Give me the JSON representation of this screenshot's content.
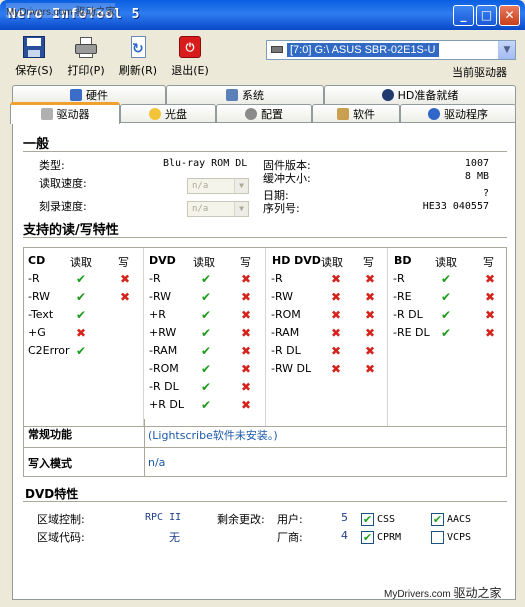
{
  "window": {
    "title": "Nero InfoTool 5",
    "watermark": "MyDrivers.com 驱动之家"
  },
  "toolbar": {
    "save": "保存(S)",
    "print": "打印(P)",
    "refresh": "刷新(R)",
    "exit": "退出(E)"
  },
  "drive": {
    "selected": "[7:0]  G:\\ ASUS    SBR-02E1S-U",
    "label": "当前驱动器"
  },
  "tabs_top": [
    "硬件",
    "系统",
    "HD准备就绪"
  ],
  "tabs_bottom": [
    "驱动器",
    "光盘",
    "配置",
    "软件",
    "驱动程序"
  ],
  "general": {
    "title": "一般",
    "type_label": "类型:",
    "type_value": "Blu-ray ROM DL",
    "read_speed_label": "读取速度:",
    "read_speed_value": "n/a",
    "write_speed_label": "刻录速度:",
    "write_speed_value": "n/a",
    "firmware_label": "固件版本:",
    "firmware_value": "1007",
    "buffer_label": "缓冲大小:",
    "buffer_value": "8 MB",
    "date_label": "日期:",
    "date_value": "?",
    "serial_label": "序列号:",
    "serial_value": "HE33  040557"
  },
  "rw": {
    "title": "支持的读/写特性",
    "read_hdr": "读取",
    "write_hdr": "写",
    "cd": {
      "name": "CD",
      "rows": [
        "-R",
        "-RW",
        "-Text",
        "+G",
        "C2Error"
      ]
    },
    "dvd": {
      "name": "DVD",
      "rows": [
        "-R",
        "-RW",
        "+R",
        "+RW",
        "-RAM",
        "-ROM",
        "-R DL",
        "+R DL"
      ]
    },
    "hddvd": {
      "name": "HD DVD",
      "rows": [
        "-R",
        "-RW",
        "-ROM",
        "-RAM",
        "-R DL",
        "-RW DL"
      ]
    },
    "bd": {
      "name": "BD",
      "rows": [
        "-R",
        "-RE",
        "-R DL",
        "-RE DL"
      ]
    }
  },
  "features": {
    "label": "常规功能",
    "value": "(Lightscribe软件未安装。)"
  },
  "write_mode": {
    "label": "写入模式",
    "value": "n/a"
  },
  "dvd_features": {
    "title": "DVD特性",
    "region_ctrl_label": "区域控制:",
    "region_ctrl_value": "RPC II",
    "region_code_label": "区域代码:",
    "region_code_value": "无",
    "changes_label": "剩余更改:",
    "user_label": "用户:",
    "user_value": "5",
    "vendor_label": "厂商:",
    "vendor_value": "4",
    "css": "CSS",
    "aacs": "AACS",
    "cprm": "CPRM",
    "vcps": "VCPS"
  },
  "footer": {
    "site": "MyDrivers.com",
    "brand": "驱动之家"
  },
  "colors": {
    "check": "#1c9a1c",
    "cross": "#d4241c",
    "titlebar": "#0a5ee0"
  }
}
